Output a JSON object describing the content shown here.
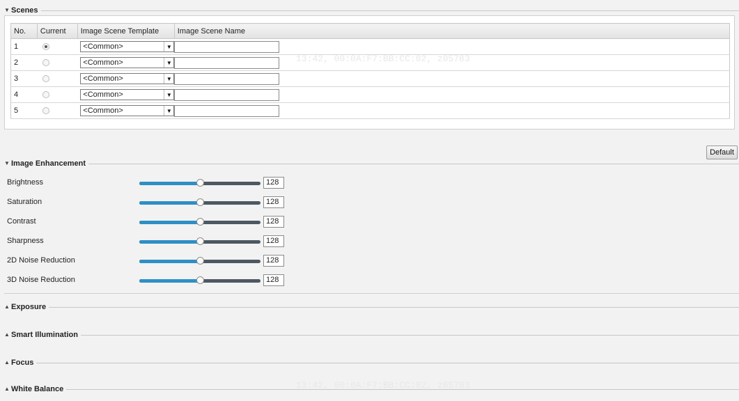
{
  "scenes": {
    "title": "Scenes",
    "columns": [
      "No.",
      "Current",
      "Image Scene Template",
      "Image Scene Name"
    ],
    "rows": [
      {
        "no": "1",
        "current": true,
        "template": "<Common>",
        "name": ""
      },
      {
        "no": "2",
        "current": false,
        "template": "<Common>",
        "name": ""
      },
      {
        "no": "3",
        "current": false,
        "template": "<Common>",
        "name": ""
      },
      {
        "no": "4",
        "current": false,
        "template": "<Common>",
        "name": ""
      },
      {
        "no": "5",
        "current": false,
        "template": "<Common>",
        "name": ""
      }
    ]
  },
  "default_button": "Default",
  "image_enhancement": {
    "title": "Image Enhancement",
    "max": 255,
    "sliders": [
      {
        "label": "Brightness",
        "value": "128"
      },
      {
        "label": "Saturation",
        "value": "128"
      },
      {
        "label": "Contrast",
        "value": "128"
      },
      {
        "label": "Sharpness",
        "value": "128"
      },
      {
        "label": "2D Noise Reduction",
        "value": "128"
      },
      {
        "label": "3D Noise Reduction",
        "value": "128"
      }
    ]
  },
  "collapsed_sections": [
    "Exposure",
    "Smart Illumination",
    "Focus",
    "White Balance"
  ],
  "watermark": "13:42, 00:0A:F7:BB:CC:82, z05783",
  "colors": {
    "slider_fill": "#2f8fc5",
    "slider_track": "#4d5862",
    "background": "#f2f2f2"
  }
}
